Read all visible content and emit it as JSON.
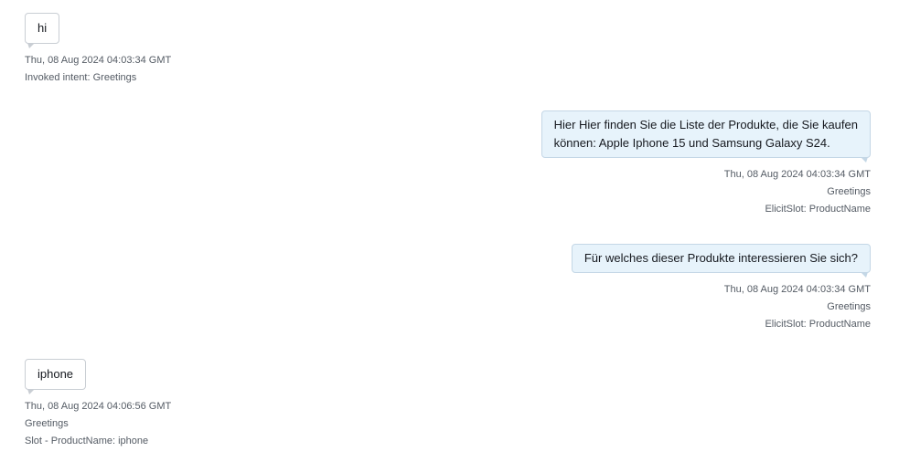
{
  "messages": [
    {
      "side": "user",
      "text": "hi",
      "timestamp": "Thu, 08 Aug 2024 04:03:34 GMT",
      "info": [
        "Invoked intent: Greetings"
      ]
    },
    {
      "side": "bot",
      "text_lines": [
        "Hier Hier finden Sie die Liste der Produkte, die Sie kaufen",
        "können: Apple Iphone 15 und Samsung Galaxy S24."
      ],
      "timestamp": "Thu, 08 Aug 2024 04:03:34 GMT",
      "info": [
        "Greetings",
        "ElicitSlot: ProductName"
      ]
    },
    {
      "side": "bot",
      "text": "Für welches dieser Produkte interessieren Sie sich?",
      "timestamp": "Thu, 08 Aug 2024 04:03:34 GMT",
      "info": [
        "Greetings",
        "ElicitSlot: ProductName"
      ]
    },
    {
      "side": "user",
      "text": "iphone",
      "timestamp": "Thu, 08 Aug 2024 04:06:56 GMT",
      "info": [
        "Greetings",
        "Slot - ProductName: iphone"
      ]
    }
  ]
}
